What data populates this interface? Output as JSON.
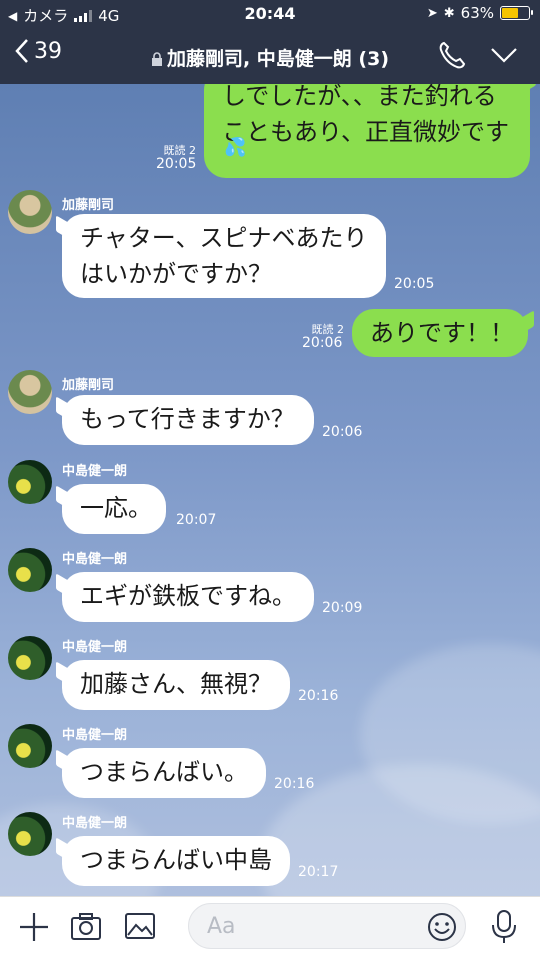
{
  "status": {
    "carrier": "カメラ",
    "network": "4G",
    "time": "20:44",
    "battery": "63%",
    "battery_level": 0.63
  },
  "header": {
    "back_count": "39",
    "title": "加藤剛司, 中島健一朗 (3)"
  },
  "messages": [
    {
      "type": "out",
      "text1": "しでしたが、、また釣れる",
      "text2": "こともあり、正直微妙です",
      "read": "既読 2",
      "time": "20:05"
    },
    {
      "type": "in",
      "sender": "加藤剛司",
      "text1": "チャター、スピナベあたり",
      "text2": "はいかがですか？",
      "time": "20:05"
    },
    {
      "type": "out",
      "text": "ありです！！",
      "read": "既読 2",
      "time": "20:06"
    },
    {
      "type": "in",
      "sender": "加藤剛司",
      "text": "もって行きますか？",
      "time": "20:06"
    },
    {
      "type": "in",
      "sender": "中島健一朗",
      "text": "一応。",
      "time": "20:07"
    },
    {
      "type": "in",
      "sender": "中島健一朗",
      "text": "エギが鉄板ですね。",
      "time": "20:09"
    },
    {
      "type": "in",
      "sender": "中島健一朗",
      "text": "加藤さん、無視？",
      "time": "20:16"
    },
    {
      "type": "in",
      "sender": "中島健一朗",
      "text": "つまらんばい。",
      "time": "20:16"
    },
    {
      "type": "in",
      "sender": "中島健一朗",
      "text": "つまらんばい中島",
      "time": "20:17"
    }
  ],
  "input": {
    "placeholder": "Aa"
  },
  "icons": [
    "back-chevron-icon",
    "lock-icon",
    "phone-icon",
    "chevron-down-icon",
    "plus-icon",
    "camera-icon",
    "image-icon",
    "emoji-icon",
    "microphone-icon",
    "sweat-drops-emoji"
  ],
  "colors": {
    "header": "#2c3447",
    "outgoing": "#8bde4e",
    "incoming": "#ffffff"
  }
}
